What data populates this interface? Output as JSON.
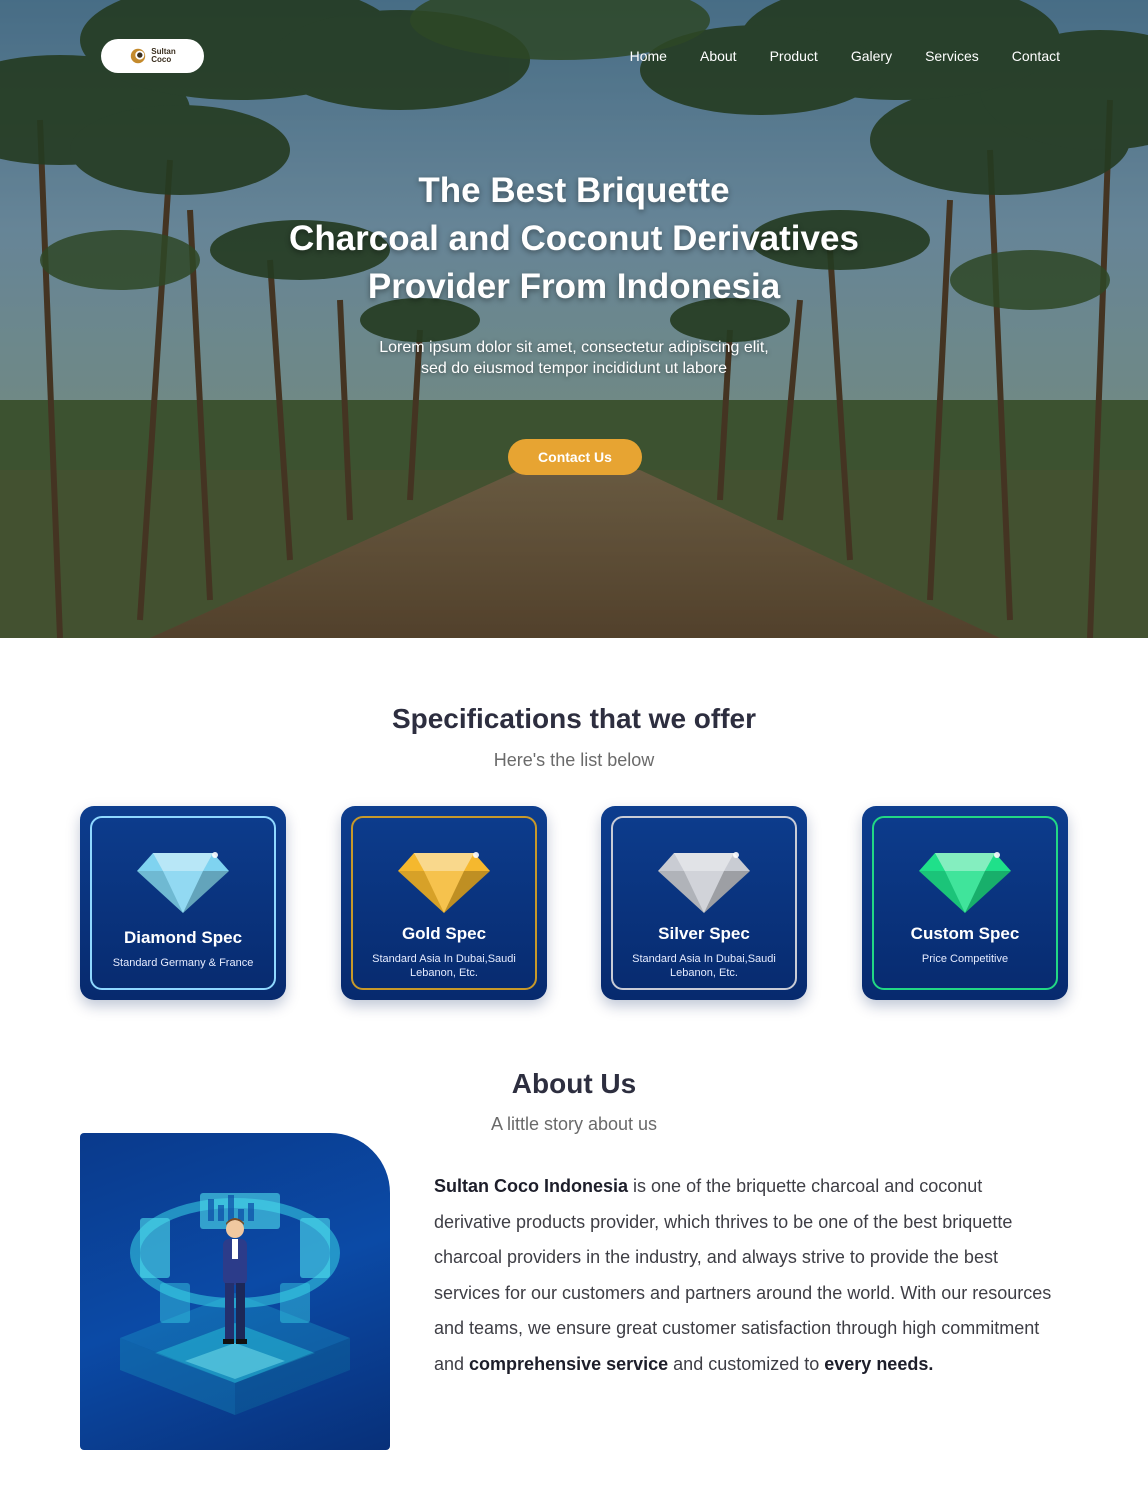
{
  "brand": {
    "name_line1": "Sultan",
    "name_line2": "Coco"
  },
  "nav": [
    "Home",
    "About",
    "Product",
    "Galery",
    "Services",
    "Contact"
  ],
  "hero": {
    "title_lines": [
      "The Best Briquette",
      "Charcoal and Coconut Derivatives",
      "Provider From Indonesia"
    ],
    "subtitle": "Lorem ipsum dolor sit amet, consectetur adipiscing elit, sed do eiusmod tempor incididunt ut labore",
    "cta": "Contact Us"
  },
  "specs": {
    "title": "Specifications that we offer",
    "subtitle": "Here's the list below",
    "cards": [
      {
        "title": "Diamond Spec",
        "desc": "Standard Germany & France",
        "gem_color": "#7fd3f0",
        "border_color": "#8fd8ff"
      },
      {
        "title": "Gold Spec",
        "desc": "Standard Asia In Dubai,Saudi Lebanon, Etc.",
        "gem_color": "#f5b82e",
        "border_color": "#c7992a"
      },
      {
        "title": "Silver Spec",
        "desc": "Standard Asia In Dubai,Saudi Lebanon, Etc.",
        "gem_color": "#c9ccd3",
        "border_color": "#c9ccd6"
      },
      {
        "title": "Custom Spec",
        "desc": "Price Competitive",
        "gem_color": "#1fe08a",
        "border_color": "#22d884"
      }
    ]
  },
  "about": {
    "title": "About Us",
    "subtitle": "A little story about us",
    "p_company": "Sultan Coco Indonesia",
    "p_text1": " is one of the briquette charcoal and coconut derivative products provider, which thrives to be one of the best briquette charcoal providers in the industry, and always strive to provide the best services for our customers and partners around the world. With our resources and teams, we ensure great customer satisfaction through high commitment and ",
    "p_bold2": "comprehensive service",
    "p_text2": " and customized to ",
    "p_bold3": "every needs."
  },
  "colors": {
    "accent": "#e7a432",
    "navy": "#0a3a8c",
    "heading": "#2d2e3f"
  }
}
